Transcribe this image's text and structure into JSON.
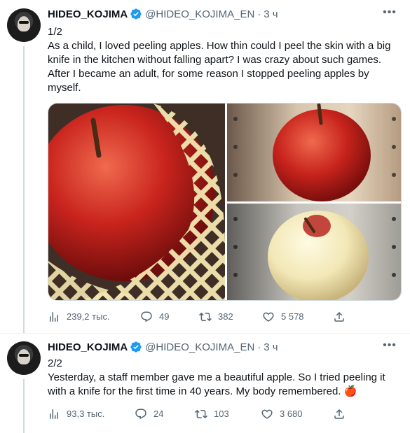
{
  "tweets": [
    {
      "author_name": "HIDEO_KOJIMA",
      "handle": "@HIDEO_KOJIMA_EN",
      "separator": "·",
      "time": "3 ч",
      "text": "1/2\nAs a child, I loved peeling apples. How thin could I peel the skin with a big knife in the kitchen without falling apart? I was crazy about such games. After I became an adult, for some reason I stopped peeling apples by myself.",
      "views": "239,2 тыс.",
      "replies": "49",
      "retweets": "382",
      "likes": "5 578"
    },
    {
      "author_name": "HIDEO_KOJIMA",
      "handle": "@HIDEO_KOJIMA_EN",
      "separator": "·",
      "time": "3 ч",
      "text": "2/2\nYesterday, a staff member gave me a beautiful apple. So I tried peeling it with a knife for the first time in 40 years. My body remembered. 🍎",
      "views": "93,3 тыс.",
      "replies": "24",
      "retweets": "103",
      "likes": "3 680"
    }
  ],
  "icons": {
    "verified": "verified-badge-icon",
    "more": "more-dots-icon",
    "views": "bar-chart-icon",
    "reply": "reply-bubble-icon",
    "retweet": "retweet-icon",
    "like": "heart-icon",
    "share": "share-upload-icon"
  },
  "colors": {
    "verified_blue": "#1d9bf0",
    "text": "#0f1419",
    "secondary_text": "#536471",
    "thread_line": "#cfd9de"
  }
}
